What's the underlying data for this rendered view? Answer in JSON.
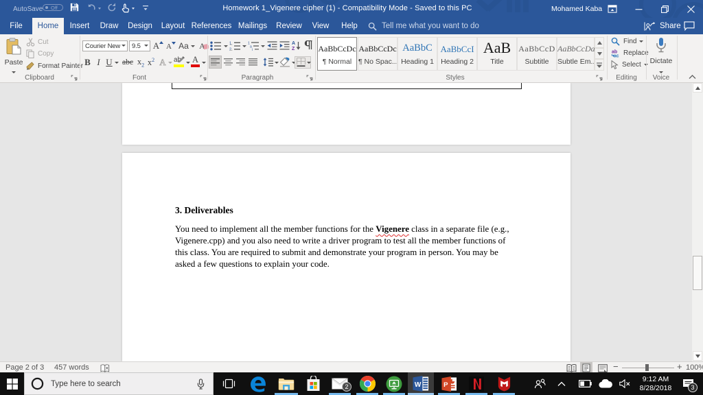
{
  "titlebar": {
    "autosave_label": "AutoSave",
    "autosave_state": "Off",
    "title": "Homework 1_Vigenere cipher (1)  -  Compatibility Mode  -  Saved to this PC",
    "user_name": "Mohamed Kaba"
  },
  "tabs": [
    {
      "label": "File"
    },
    {
      "label": "Home",
      "active": true
    },
    {
      "label": "Insert"
    },
    {
      "label": "Draw"
    },
    {
      "label": "Design"
    },
    {
      "label": "Layout"
    },
    {
      "label": "References"
    },
    {
      "label": "Mailings"
    },
    {
      "label": "Review"
    },
    {
      "label": "View"
    },
    {
      "label": "Help"
    }
  ],
  "tellme": "Tell me what you want to do",
  "share_label": "Share",
  "ribbon": {
    "clipboard": {
      "group_label": "Clipboard",
      "paste_label": "Paste",
      "cut_label": "Cut",
      "copy_label": "Copy",
      "format_painter_label": "Format Painter"
    },
    "font": {
      "group_label": "Font",
      "font_name": "Courier New",
      "font_size": "9.5",
      "bold": "B",
      "italic": "I",
      "underline": "U",
      "strikethrough": "abc",
      "grow": "A",
      "shrink": "A",
      "case": "Aa",
      "clear": "A",
      "effects": "A",
      "highlight": "ab",
      "color": "A",
      "sub": "x",
      "sub2": "2",
      "sup": "x",
      "sup2": "2"
    },
    "paragraph": {
      "group_label": "Paragraph"
    },
    "styles": {
      "group_label": "Styles",
      "items": [
        {
          "sample": "AaBbCcDc",
          "name": "¶ Normal",
          "color": "#222222",
          "selected": true
        },
        {
          "sample": "AaBbCcDc",
          "name": "¶ No Spac...",
          "color": "#222222"
        },
        {
          "sample": "AaBbC",
          "name": "Heading 1",
          "color": "#2e74b5"
        },
        {
          "sample": "AaBbCcI",
          "name": "Heading 2",
          "color": "#2e74b5"
        },
        {
          "sample": "AaB",
          "name": "Title",
          "color": "#1a1a1a"
        },
        {
          "sample": "AaBbCcD",
          "name": "Subtitle",
          "color": "#5a5a5a"
        },
        {
          "sample": "AaBbCcDa",
          "name": "Subtle Em...",
          "color": "#6a6a6a"
        }
      ]
    },
    "editing": {
      "group_label": "Editing",
      "find_label": "Find",
      "replace_label": "Replace",
      "select_label": "Select"
    },
    "voice": {
      "group_label": "Voice",
      "dictate_label": "Dictate"
    }
  },
  "document": {
    "heading": "3. Deliverables",
    "para_line1_pre": "You need to implement all the member functions for the ",
    "para_line1_bold": "Vigenere",
    "para_line1_post": " class in a separate file (e.g.,",
    "para_line2": "Vigenere.cpp) and you also need to write a driver program to test all the member functions of",
    "para_line3": "this class. You are required to submit and demonstrate your program in person. You may be",
    "para_line4": "asked a few questions to explain your code."
  },
  "statusbar": {
    "page_info": "Page 2 of 3",
    "word_count": "457 words",
    "zoom_level": "100%"
  },
  "taskbar": {
    "search_placeholder": "Type here to search",
    "mail_badge": "2",
    "action_badge": "3",
    "time": "9:12 AM",
    "date": "8/28/2018"
  },
  "colors": {
    "accent_blue": "#2b579a",
    "heading_blue": "#2e74b5",
    "taskbar_underline": "#76b9ed",
    "squiggle_red": "#e03030"
  }
}
